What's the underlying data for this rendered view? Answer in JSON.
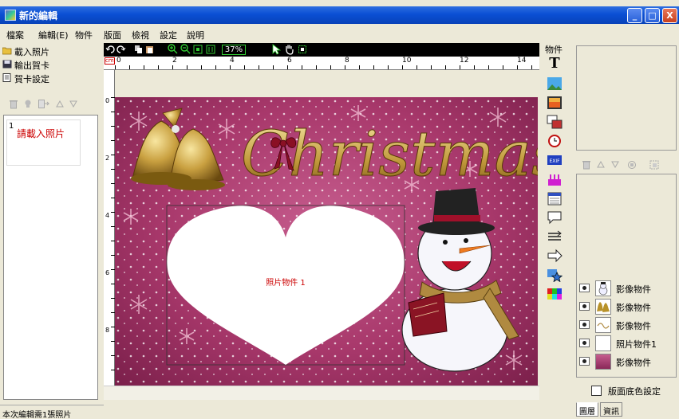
{
  "window": {
    "title": "新的編輯",
    "min_label": "_",
    "max_label": "□",
    "close_label": "X"
  },
  "menu": [
    "檔案",
    "編輯(E)",
    "物件",
    "版面",
    "檢視",
    "設定",
    "說明"
  ],
  "left_panel": {
    "commands": [
      "載入照片",
      "輸出賀卡",
      "賀卡設定"
    ],
    "thumb_number": "1",
    "thumb_text": "請載入照片"
  },
  "status": "本次編輯需1張照片",
  "editor": {
    "zoom": "37%",
    "ruler_unit": "cm",
    "ruler_marks": [
      "0",
      "2",
      "4",
      "6",
      "8",
      "10",
      "12",
      "14"
    ],
    "vruler_marks": [
      "0",
      "2",
      "4",
      "6",
      "8"
    ]
  },
  "card": {
    "title": "Christmas",
    "photo_placeholder": "照片物件 1",
    "colors": {
      "background": "#a8386b",
      "heart": "#ffffff",
      "placeholder_text": "#cc0000"
    }
  },
  "tools": {
    "header": "物件",
    "items": [
      "text-tool",
      "image-tool",
      "photo-tool",
      "frame-tool",
      "clock-tool",
      "exif-tool",
      "cake-tool",
      "calendar-tool",
      "speech-bubble-tool",
      "line-tool",
      "arrow-tool",
      "star-tool",
      "color-tool"
    ],
    "text_glyph": "T",
    "exif_label": "EXIF"
  },
  "layers": [
    {
      "name": "影像物件",
      "thumb": "snowman"
    },
    {
      "name": "影像物件",
      "thumb": "bells"
    },
    {
      "name": "影像物件",
      "thumb": "christmas-text"
    },
    {
      "name": "照片物件1",
      "thumb": "photo"
    },
    {
      "name": "影像物件",
      "thumb": "background"
    }
  ],
  "bg_color_setting": "版面底色設定",
  "tabs": [
    "圖層",
    "資訊"
  ]
}
